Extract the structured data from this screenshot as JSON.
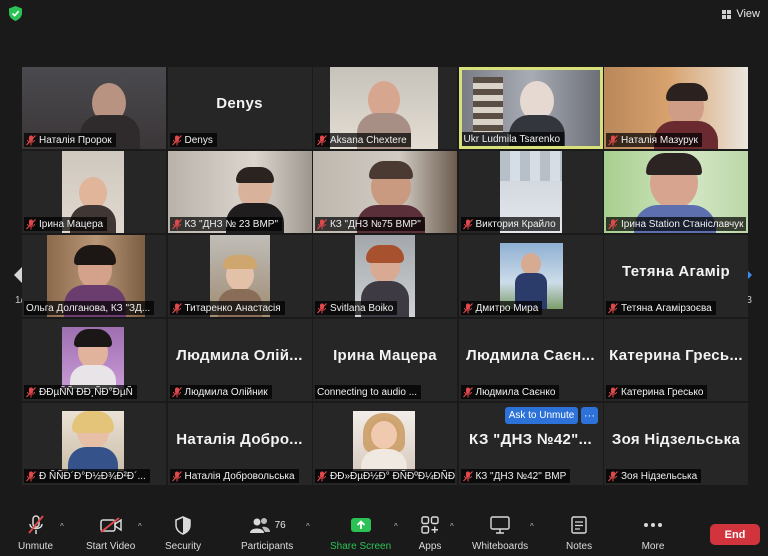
{
  "header": {
    "view_label": "View"
  },
  "navigation": {
    "page_left": "1/3",
    "page_right": "1/3"
  },
  "participants": [
    {
      "name": "Наталія Пророк",
      "big": ""
    },
    {
      "name": "Denys",
      "big": "Denys"
    },
    {
      "name": "Aksana Chextere",
      "big": ""
    },
    {
      "name": "Ukr Ludmila Tsarenko",
      "big": ""
    },
    {
      "name": "Наталія Мазурук",
      "big": ""
    },
    {
      "name": "Ірина Мацера",
      "big": ""
    },
    {
      "name": "КЗ \"ДНЗ № 23 ВМР\"",
      "big": ""
    },
    {
      "name": "КЗ \"ДНЗ №75 ВМР\"",
      "big": ""
    },
    {
      "name": "Виктория Крайло",
      "big": ""
    },
    {
      "name": "Ірина Station Станіславчук",
      "big": ""
    },
    {
      "name": "Ольга Долганова, КЗ \"ЗД...",
      "big": ""
    },
    {
      "name": "Титаренко Анастасія",
      "big": ""
    },
    {
      "name": "Svitlana Boiko",
      "big": ""
    },
    {
      "name": "Дмитро Мира",
      "big": ""
    },
    {
      "name": "Тетяна Агамірзоєва",
      "big": "Тетяна Агамір"
    },
    {
      "name": "ÐÐµÑÑ ÐÐ¸ÑÐ°ÐµÑ",
      "big": ""
    },
    {
      "name": "Людмила Олійник",
      "big": "Людмила Олій..."
    },
    {
      "name": "Connecting to audio ...",
      "big": "Ірина Мацера"
    },
    {
      "name": "Людмила Саєнко",
      "big": "Людмила Саєн..."
    },
    {
      "name": "Катерина Гресько",
      "big": "Катерина Гресь..."
    },
    {
      "name": "Ð ÑÑÐ´Ð°Ð½Ð¾Ð²Ð´...",
      "big": ""
    },
    {
      "name": "Наталія Добровольська",
      "big": "Наталія Добро..."
    },
    {
      "name": "ÐÐ»ÐµÐ½Ð° ÐÑÐºÐ¼ÐÑÐ...",
      "big": ""
    },
    {
      "name": "КЗ \"ДНЗ №42\" ВМР",
      "big": "КЗ \"ДНЗ №42\"..."
    },
    {
      "name": "Зоя Нідзельська",
      "big": "Зоя Нідзельська"
    }
  ],
  "popup": {
    "ask_unmute": "Ask to Unmute",
    "more": "···"
  },
  "toolbar": {
    "unmute": "Unmute",
    "start_video": "Start Video",
    "security": "Security",
    "participants": "Participants",
    "participants_count": "76",
    "share_screen": "Share Screen",
    "apps": "Apps",
    "whiteboards": "Whiteboards",
    "notes": "Notes",
    "more": "More",
    "end": "End"
  },
  "colors": {
    "active_border": "#d8e07a",
    "share_green": "#2bc255",
    "end_red": "#d1343d",
    "ask_blue": "#2d72d9"
  }
}
